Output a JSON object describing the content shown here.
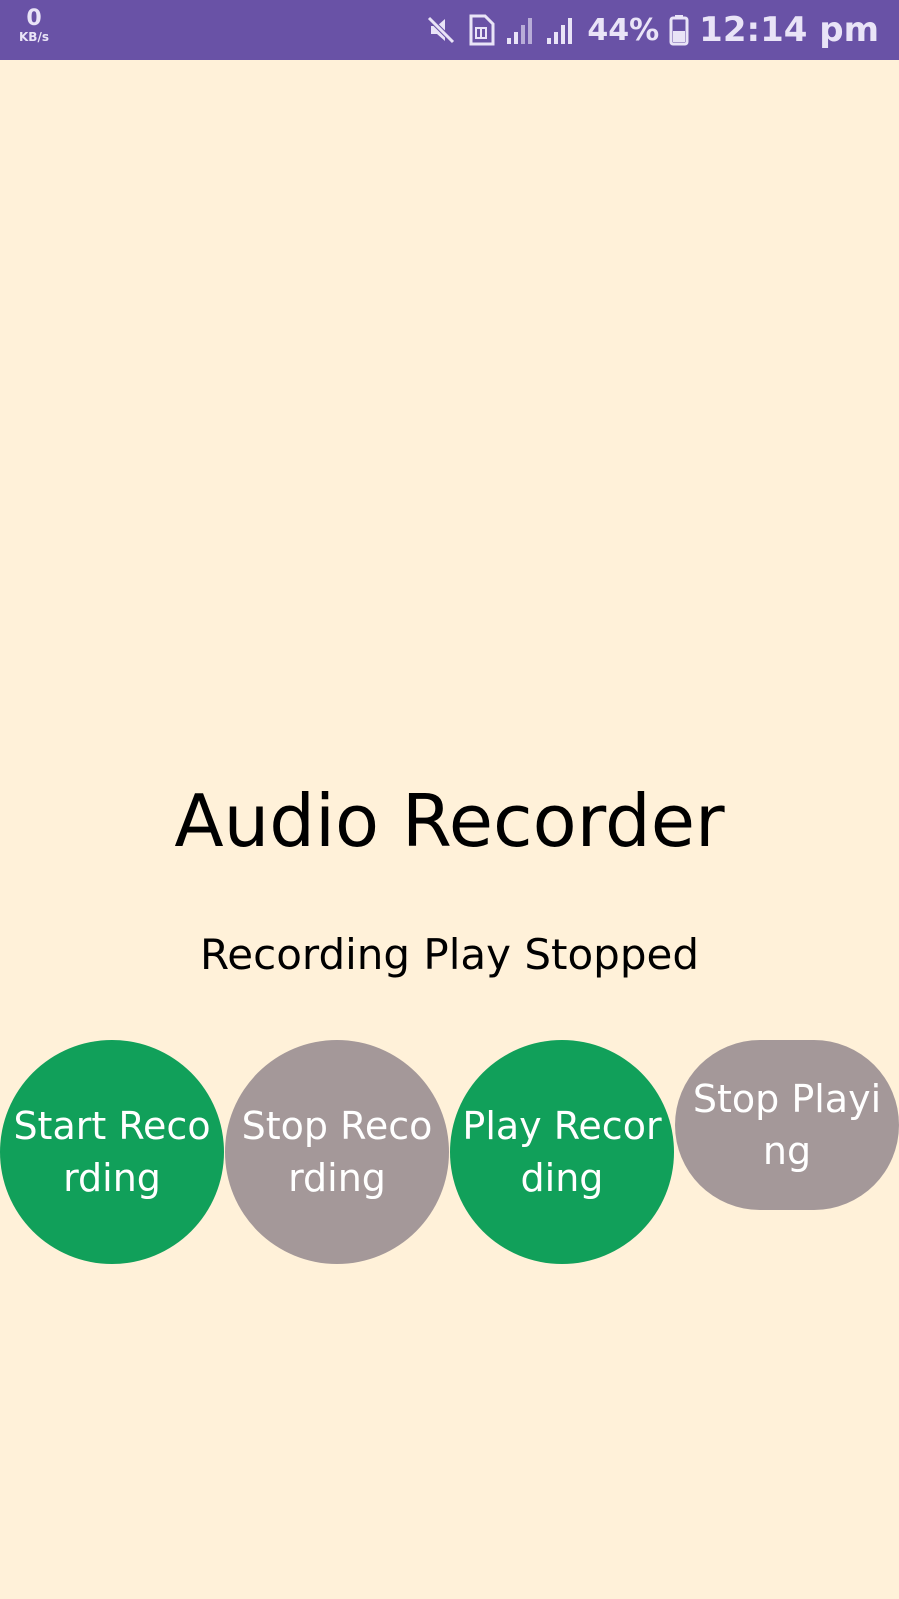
{
  "status_bar": {
    "net_speed_value": "0",
    "net_speed_unit": "KB/s",
    "icons": [
      "mute-icon",
      "sim-card-icon",
      "signal-icon",
      "signal-icon"
    ],
    "battery_percent": "44%",
    "time": "12:14 pm",
    "background_color": "#6952a6"
  },
  "app": {
    "background_color": "#fff1d9",
    "title": "Audio Recorder",
    "status_message": "Recording Play Stopped"
  },
  "buttons": {
    "start_recording": {
      "label": "Start Recording",
      "color": "#11a05a"
    },
    "stop_recording": {
      "label": "Stop Recording",
      "color": "#a49899"
    },
    "play_recording": {
      "label": "Play Recording",
      "color": "#11a05a"
    },
    "stop_playing": {
      "label": "Stop Playing",
      "color": "#a49899"
    }
  }
}
